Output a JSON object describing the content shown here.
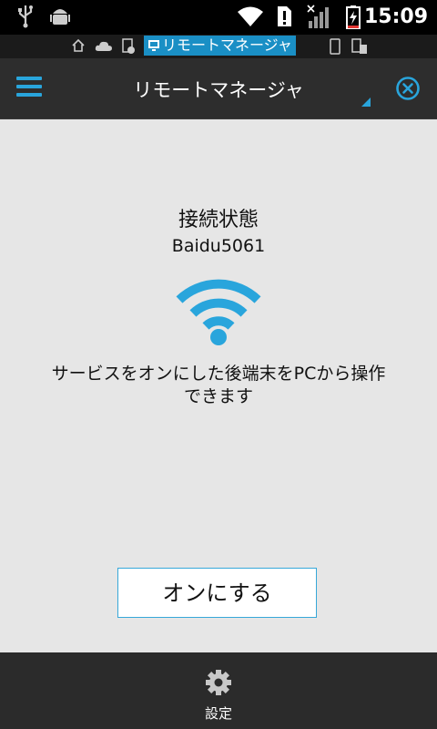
{
  "status_bar": {
    "time": "15:09",
    "icons": [
      "usb-icon",
      "android-debug-icon",
      "wifi-signal-icon",
      "alert-icon",
      "cell-signal-icon",
      "battery-charging-icon"
    ]
  },
  "notification_strip": {
    "app_label": "リモートマネージャ",
    "icons": [
      "home-icon",
      "cloud-icon",
      "app-icon",
      "remote-manager-icon",
      "phone-icon",
      "devices-icon"
    ]
  },
  "action_bar": {
    "title": "リモートマネージャ",
    "menu_icon": "hamburger-menu-icon",
    "close_icon": "close-circle-icon"
  },
  "main": {
    "status_title": "接続状態",
    "device_name": "Baidu5061",
    "description_line1": "サービスをオンにした後端末をPCから操作",
    "description_line2": "できます",
    "on_button": "オンにする"
  },
  "bottom_bar": {
    "settings_label": "設定"
  },
  "colors": {
    "accent": "#29a5dc",
    "background": "#e6e6e6",
    "bar": "#2d2d2d"
  }
}
